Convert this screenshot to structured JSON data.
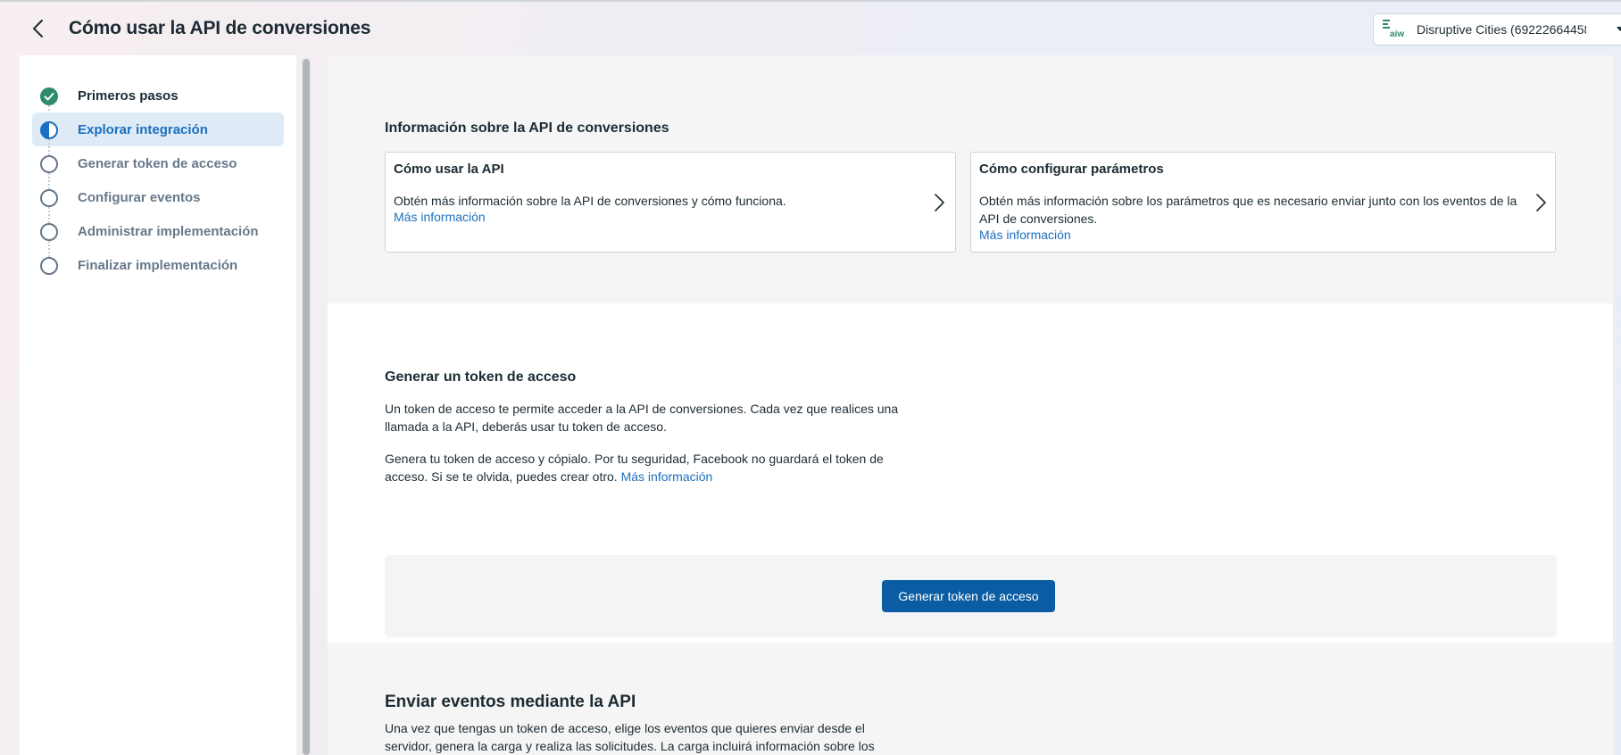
{
  "header": {
    "title": "Cómo usar la API de conversiones",
    "account": {
      "name": "Disruptive Cities (692226644589...",
      "logo_text": "aiw"
    }
  },
  "sidebar": {
    "steps": [
      {
        "label": "Primeros pasos",
        "status": "done"
      },
      {
        "label": "Explorar integración",
        "status": "active"
      },
      {
        "label": "Generar token de acceso",
        "status": "pending"
      },
      {
        "label": "Configurar eventos",
        "status": "pending"
      },
      {
        "label": "Administrar implementación",
        "status": "pending"
      },
      {
        "label": "Finalizar implementación",
        "status": "pending"
      }
    ]
  },
  "info_section": {
    "title": "Información sobre la API de conversiones",
    "cards": [
      {
        "title": "Cómo usar la API",
        "description": "Obtén más información sobre la API de conversiones y cómo funciona.",
        "link": "Más información"
      },
      {
        "title": "Cómo configurar parámetros",
        "description": "Obtén más información sobre los parámetros que es necesario enviar junto con los eventos de la API de conversiones.",
        "link": "Más información"
      }
    ]
  },
  "token_section": {
    "title": "Generar un token de acceso",
    "paragraph1": "Un token de acceso te permite acceder a la API de conversiones. Cada vez que realices una llamada a la API, deberás usar tu token de acceso.",
    "paragraph2": "Genera tu token de acceso y cópialo. Por tu seguridad, Facebook no guardará el token de acceso. Si se te olvida, puedes crear otro.",
    "paragraph2_link": "Más información",
    "button_label": "Generar token de acceso"
  },
  "events_section": {
    "title": "Enviar eventos mediante la API",
    "paragraph": "Una vez que tengas un token de acceso, elige los eventos que quieres enviar desde el servidor, genera la carga y realiza las solicitudes. La carga incluirá información sobre los"
  },
  "colors": {
    "accent": "#1b6fc0",
    "button": "#0a5da2",
    "done": "#2e8b6f",
    "active_bg": "#deebf7"
  }
}
